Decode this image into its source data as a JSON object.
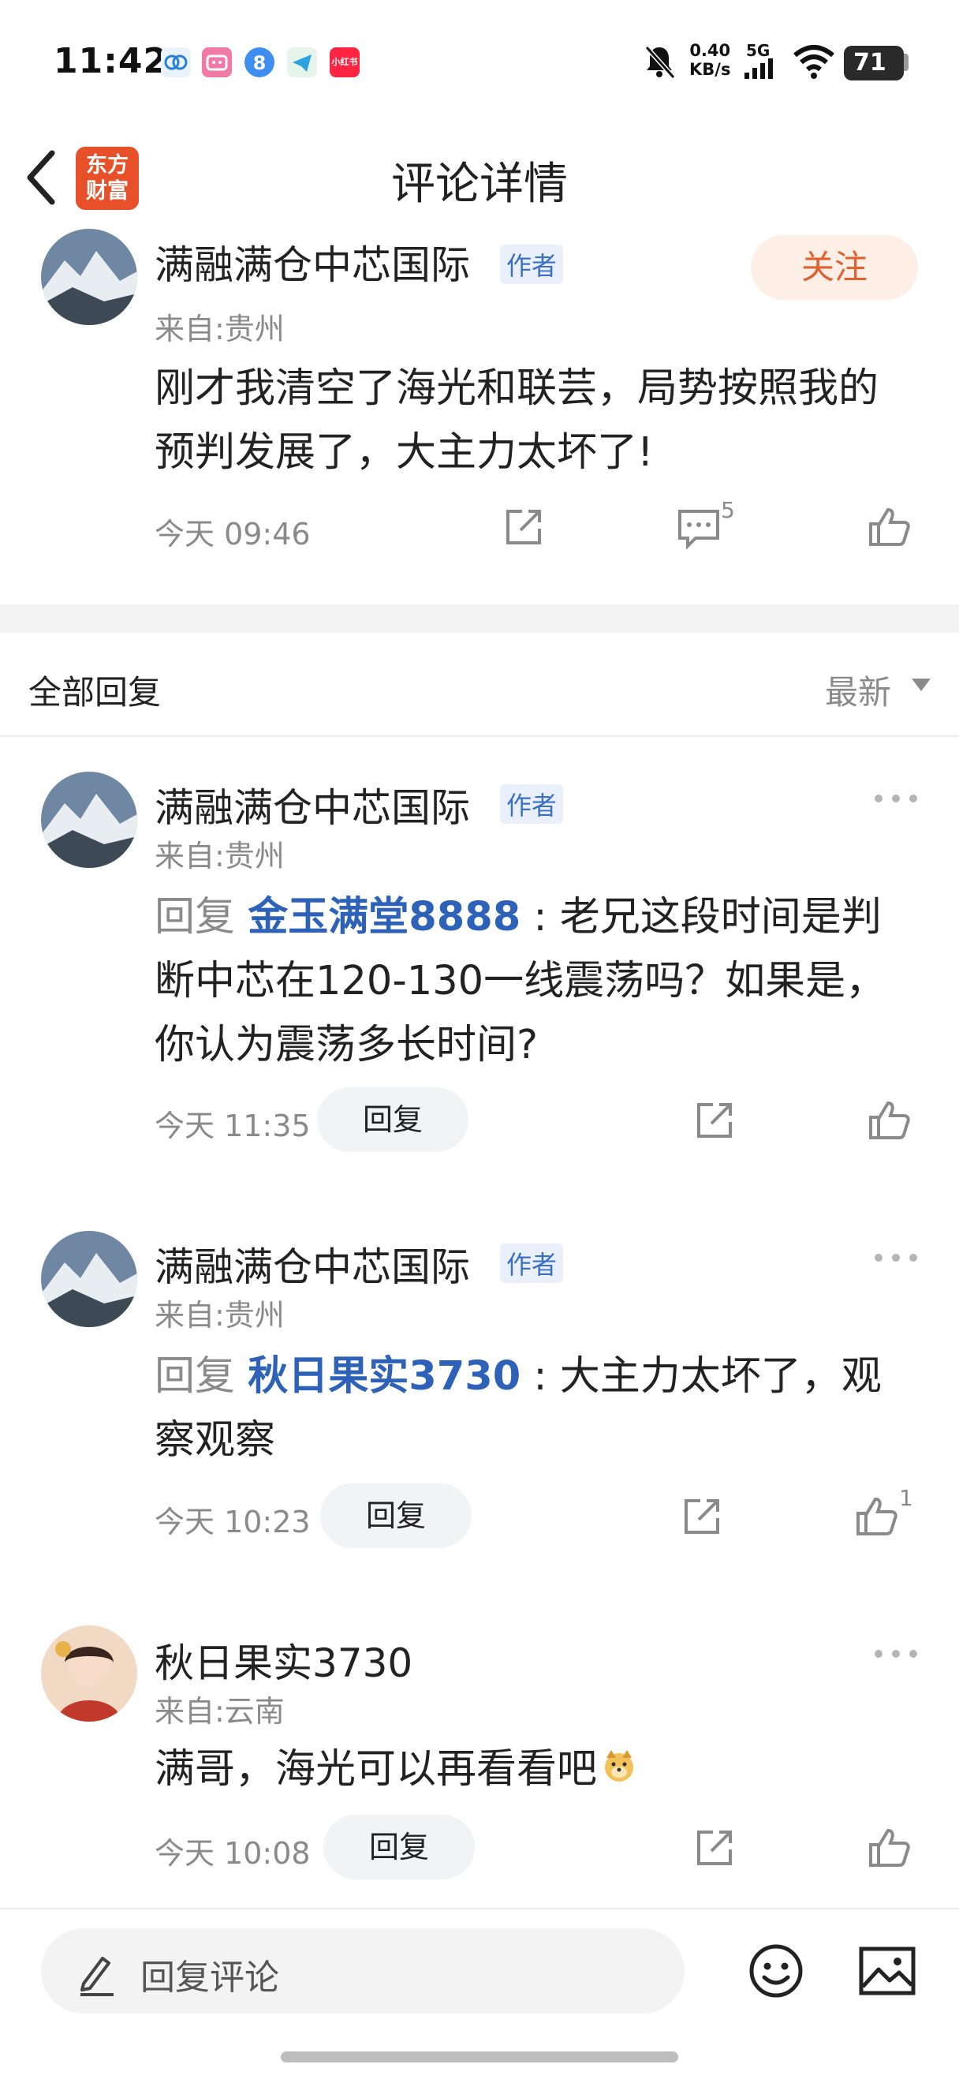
{
  "status_bar": {
    "time": "11:42",
    "speed_value": "0.40",
    "speed_unit": "KB/s",
    "network": "5G",
    "battery": "71",
    "app_icons": [
      "app-icon-1",
      "bilibili-icon",
      "app-icon-3",
      "telegram-icon",
      "xiaohongshu-icon"
    ],
    "xhs_label": "小红书"
  },
  "header": {
    "title": "评论详情",
    "logo_line1": "东方",
    "logo_line2": "财富"
  },
  "main_comment": {
    "username": "满融满仓中芯国际",
    "author_tag": "作者",
    "location": "来自:贵州",
    "follow_label": "关注",
    "text_line1": "刚才我清空了海光和联芸，局势按照我的",
    "text_line2": "预判发展了，大主力太坏了!",
    "time": "今天 09:46",
    "comment_count": "5"
  },
  "replies_header": {
    "title": "全部回复",
    "sort": "最新"
  },
  "replies": [
    {
      "username": "满融满仓中芯国际",
      "author_tag": "作者",
      "location": "来自:贵州",
      "prefix": "回复",
      "mention": "金玉满堂8888",
      "text_line1": " : 老兄这段时间是判",
      "text_line2": "断中芯在120-130一线震荡吗？如果是，",
      "text_line3": "你认为震荡多长时间?",
      "time": "今天 11:35",
      "reply_label": "回复",
      "likes": ""
    },
    {
      "username": "满融满仓中芯国际",
      "author_tag": "作者",
      "location": "来自:贵州",
      "prefix": "回复",
      "mention": "秋日果实3730",
      "text_line1": " : 大主力太坏了，观",
      "text_line2": "察观察",
      "time": "今天 10:23",
      "reply_label": "回复",
      "likes": "1"
    },
    {
      "username": "秋日果实3730",
      "location": "来自:云南",
      "text_line1": "满哥，海光可以再看看吧",
      "time": "今天 10:08",
      "reply_label": "回复",
      "likes": ""
    }
  ],
  "bottom_bar": {
    "input_placeholder": "回复评论"
  },
  "colors": {
    "accent_orange": "#e0602f",
    "logo_red": "#e8502a",
    "mention_blue": "#2d62b8",
    "tag_blue": "#3b6fc4"
  }
}
